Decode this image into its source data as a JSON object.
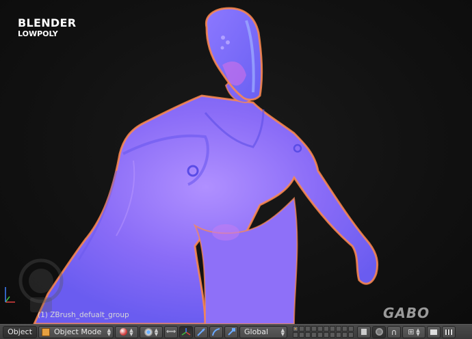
{
  "viewport": {
    "title": "BLENDER",
    "subtitle": "LOWPOLY",
    "object_label": "(1) ZBrush_defualt_group",
    "watermark": "GABO",
    "model_colors": {
      "base": "#8a6cf7",
      "highlight": "#b48cff",
      "shadow": "#5e4fe6",
      "rim": "#ff8a4c"
    },
    "axis_colors": {
      "x": "#e04040",
      "y": "#40c040",
      "z": "#4080ff"
    }
  },
  "header": {
    "editor_menu": "Object",
    "mode": "Object Mode",
    "orientation": "Global",
    "icons": [
      "object-mode-icon",
      "viewport-shading-icon",
      "pivot-point-icon",
      "manipulator-icon",
      "translate-icon",
      "rotate-icon",
      "scale-icon",
      "layers-icon",
      "render-layer-icon",
      "proportional-edit-icon",
      "snap-icon",
      "render-icon",
      "render-animation-icon"
    ]
  }
}
